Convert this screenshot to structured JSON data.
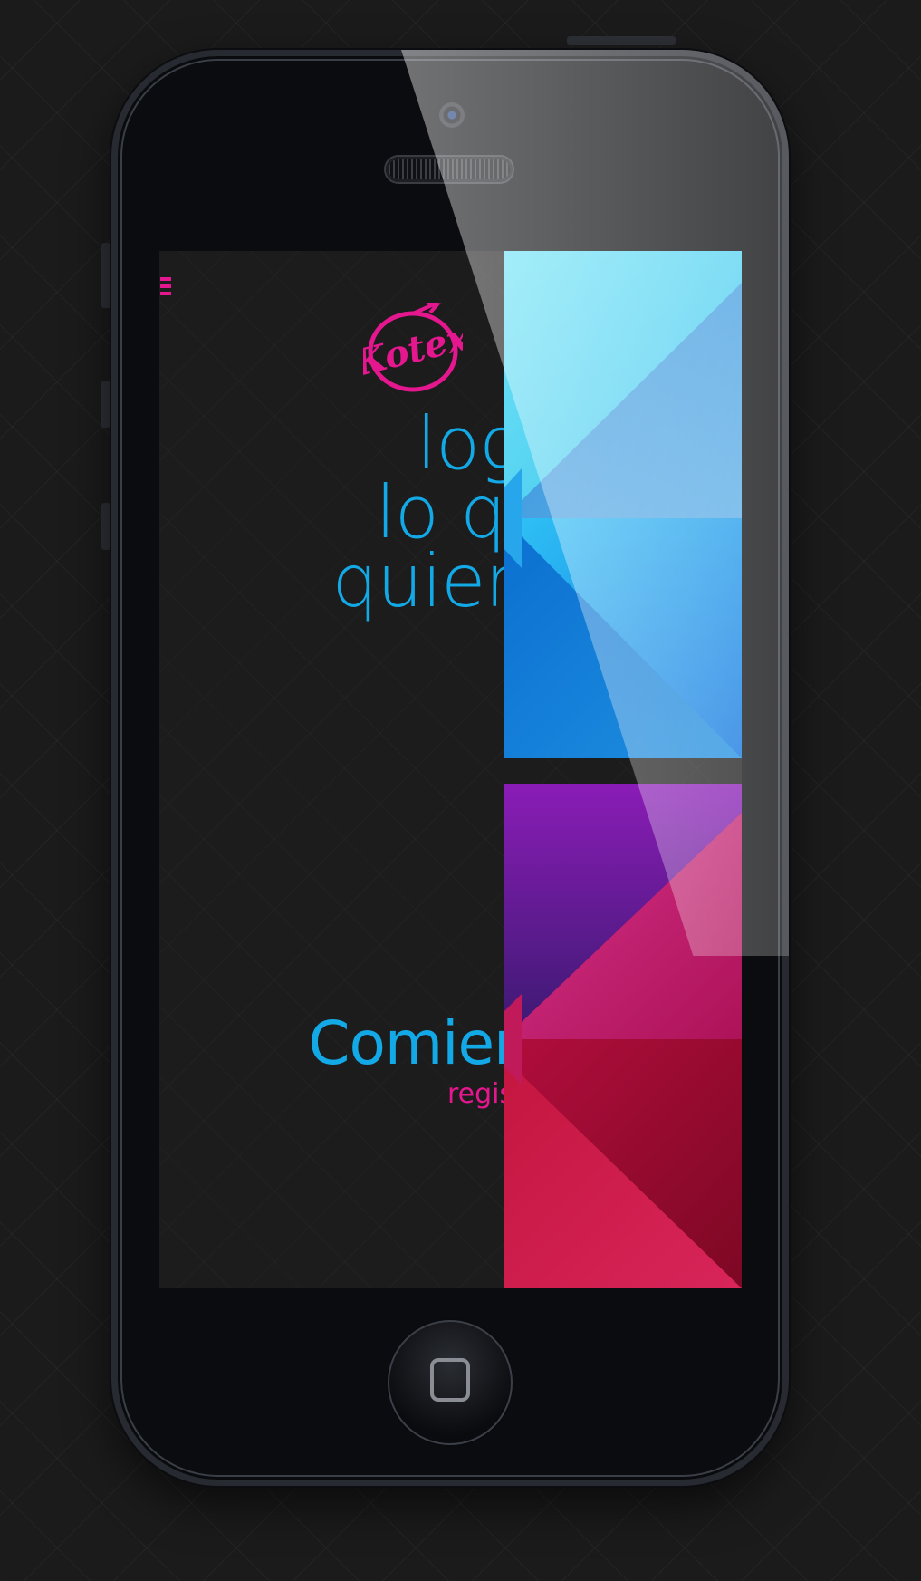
{
  "app": {
    "brand": "Kotex",
    "headline": [
      "logra",
      "lo que",
      "quieras"
    ],
    "cta_label": "Comienza",
    "secondary_link": "registrarse"
  },
  "icons": {
    "menu": "menu-icon",
    "home": "home-button-icon"
  },
  "colors": {
    "accent_blue": "#13a9e6",
    "accent_pink": "#e5178f",
    "background": "#1c1c1c"
  }
}
